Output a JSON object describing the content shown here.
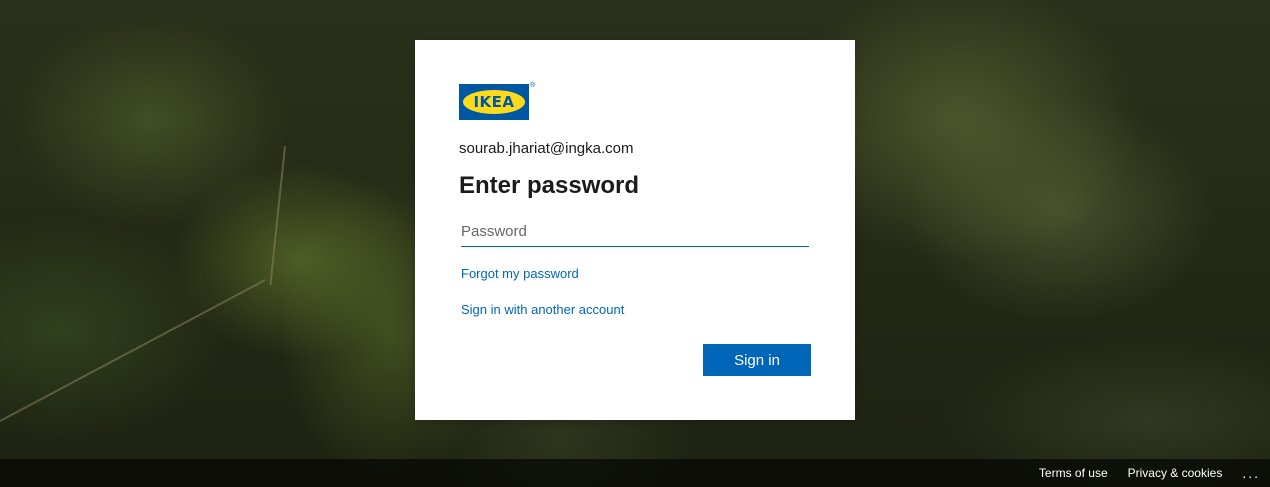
{
  "brand": {
    "logo_text": "IKEA",
    "registered_mark": "®",
    "colors": {
      "blue": "#0058a3",
      "yellow": "#ffda1a"
    }
  },
  "signin": {
    "identity": "sourab.jhariat@ingka.com",
    "title": "Enter password",
    "password_placeholder": "Password",
    "forgot_link": "Forgot my password",
    "other_account_link": "Sign in with another account",
    "submit_label": "Sign in"
  },
  "footer": {
    "terms": "Terms of use",
    "privacy": "Privacy & cookies",
    "more": "..."
  },
  "theme": {
    "accent": "#0067b8",
    "text": "#1b1b1b",
    "card_bg": "#ffffff"
  }
}
